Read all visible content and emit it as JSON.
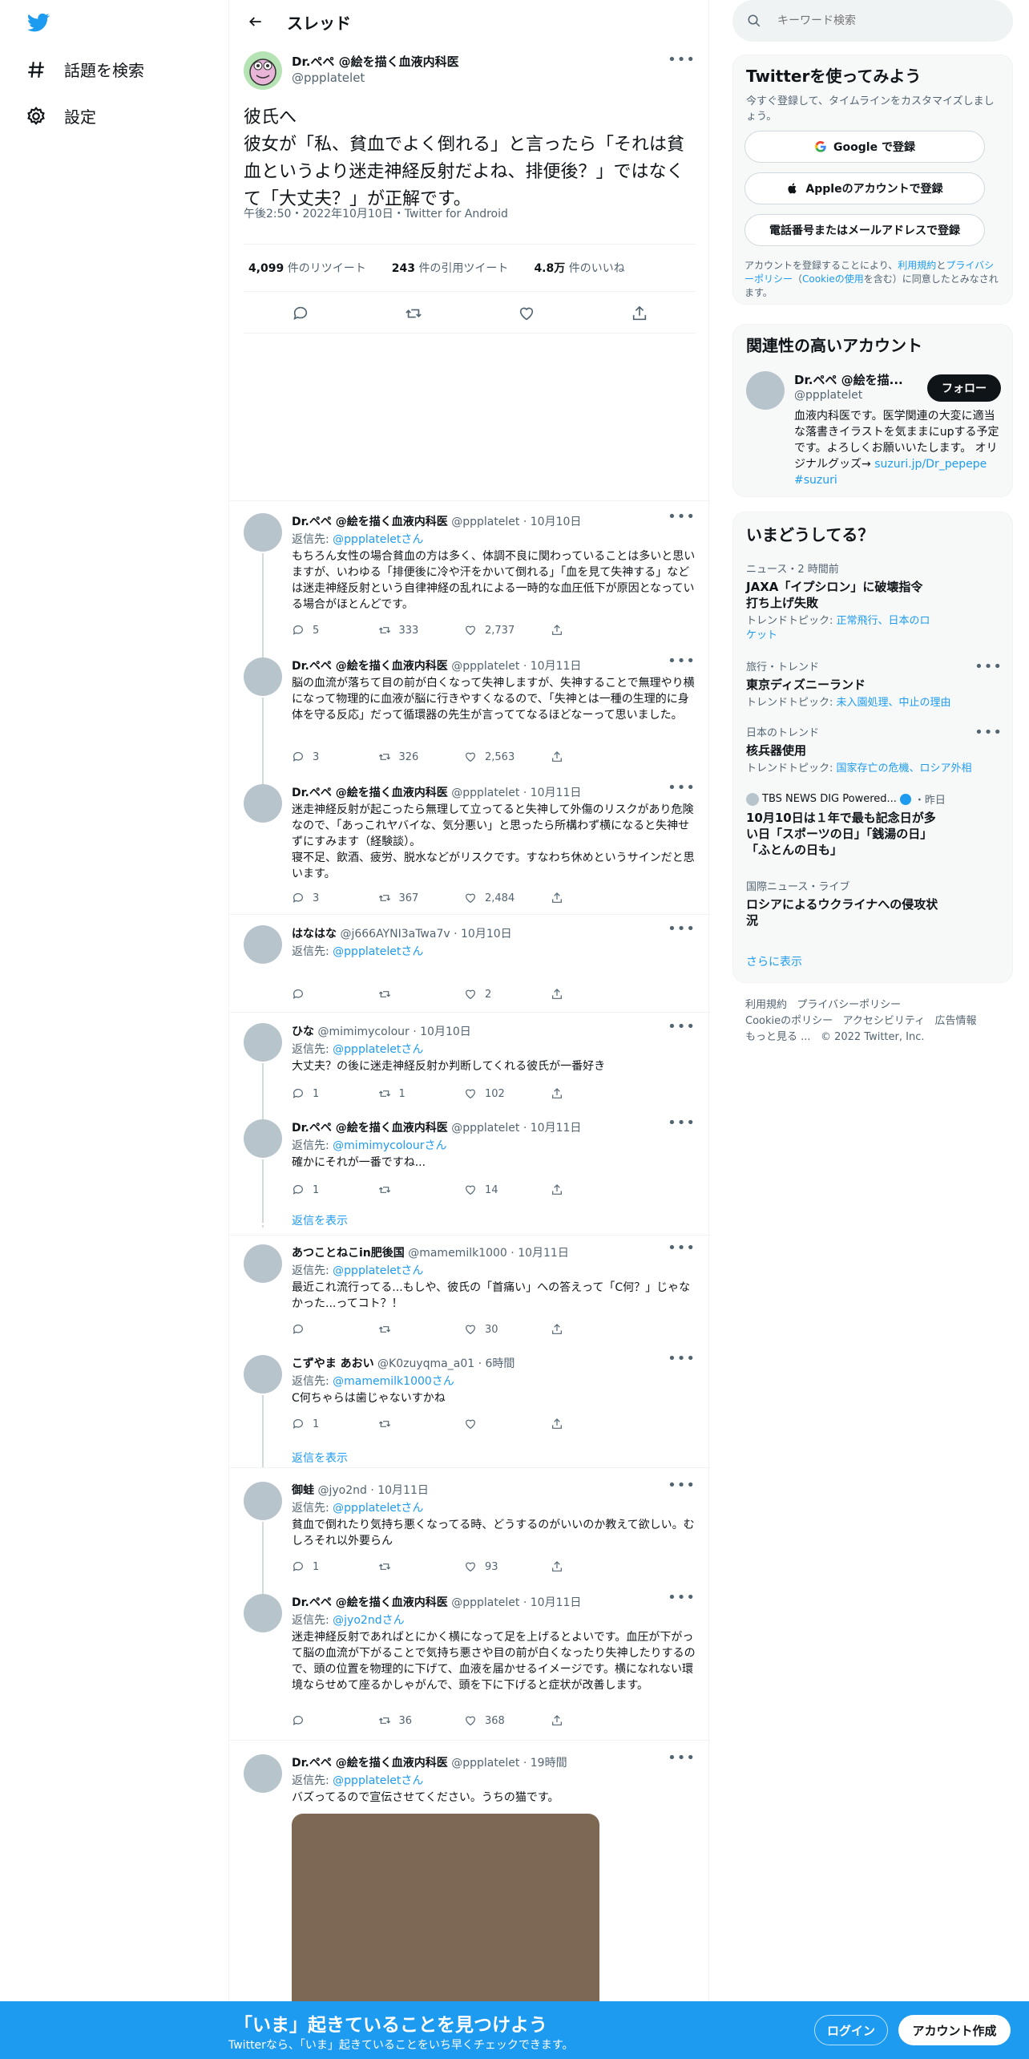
{
  "nav": {
    "explore": "話題を検索",
    "settings": "設定"
  },
  "header": {
    "title": "スレッド"
  },
  "main_tweet": {
    "name": "Dr.ペペ @絵を描く血液内科医",
    "handle": "@ppplatelet",
    "text": "彼氏へ\n彼女が「私、貧血でよく倒れる」と言ったら「それは貧血というより迷走神経反射だよね、排便後？」ではなくて「大丈夫？」が正解です。",
    "meta": "午後2:50・2022年10月10日・Twitter for Android",
    "retweets_num": "4,099",
    "retweets_label": "件のリツイート",
    "quotes_num": "243",
    "quotes_label": "件の引用ツイート",
    "likes_num": "4.8万",
    "likes_label": "件のいいね"
  },
  "replies": [
    {
      "name": "Dr.ペペ @絵を描く血液内科医",
      "handle": "@ppplatelet",
      "time": "· 10月10日",
      "reply_to_prefix": "返信先: ",
      "reply_to": "@ppplatelet",
      "reply_to_suffix": "さん",
      "text": "もちろん女性の場合貧血の方は多く、体調不良に関わっていることは多いと思いますが、いわゆる「排便後に冷や汗をかいて倒れる」「血を見て失神する」などは迷走神経反射という自律神経の乱れによる一時的な血圧低下が原因となっている場合がほとんどです。",
      "replies": "5",
      "retweets": "333",
      "likes": "2,737"
    },
    {
      "name": "Dr.ペペ @絵を描く血液内科医",
      "handle": "@ppplatelet",
      "time": "· 10月11日",
      "text": "脳の血流が落ちて目の前が白くなって失神しますが、失神することで無理やり横になって物理的に血液が脳に行きやすくなるので、「失神とは一種の生理的に身体を守る反応」だって循環器の先生が言っててなるほどなーって思いました。",
      "replies": "3",
      "retweets": "326",
      "likes": "2,563"
    },
    {
      "name": "Dr.ペペ @絵を描く血液内科医",
      "handle": "@ppplatelet",
      "time": "· 10月11日",
      "text": "迷走神経反射が起こったら無理して立ってると失神して外傷のリスクがあり危険なので、「あっこれヤバイな、気分悪い」と思ったら所構わず横になると失神せずにすみます（経験談）。\n寝不足、飲酒、疲労、脱水などがリスクです。すなわち休めというサインだと思います。",
      "replies": "3",
      "retweets": "367",
      "likes": "2,484"
    },
    {
      "name": "はなはな",
      "handle": "@j666AYNI3aTwa7v",
      "time": "· 10月10日",
      "reply_to_prefix": "返信先: ",
      "reply_to": "@ppplatelet",
      "reply_to_suffix": "さん",
      "text": "",
      "replies": "",
      "retweets": "",
      "likes": "2"
    },
    {
      "name": "ひな",
      "handle": "@mimimycolour",
      "time": "· 10月10日",
      "reply_to_prefix": "返信先: ",
      "reply_to": "@ppplatelet",
      "reply_to_suffix": "さん",
      "text": "大丈夫？の後に迷走神経反射か判断してくれる彼氏が一番好き",
      "replies": "1",
      "retweets": "1",
      "likes": "102"
    },
    {
      "name": "Dr.ペペ @絵を描く血液内科医",
      "handle": "@ppplatelet",
      "time": "· 10月11日",
      "reply_to_prefix": "返信先: ",
      "reply_to": "@mimimycolour",
      "reply_to_suffix": "さん",
      "text": "確かにそれが一番ですね...",
      "replies": "1",
      "retweets": "",
      "likes": "14"
    },
    {
      "name": "あつことねこin肥後国",
      "handle": "@mamemilk1000",
      "time": "· 10月11日",
      "reply_to_prefix": "返信先: ",
      "reply_to": "@ppplatelet",
      "reply_to_suffix": "さん",
      "text": "最近これ流行ってる...もしや、彼氏の「首痛い」への答えって「C何？」じゃなかった...ってコト？！",
      "replies": "",
      "retweets": "",
      "likes": "30"
    },
    {
      "name": "こずやま あおい",
      "handle": "@K0zuyqma_a01",
      "time": "· 6時間",
      "reply_to_prefix": "返信先: ",
      "reply_to": "@mamemilk1000",
      "reply_to_suffix": "さん",
      "text": "C何ちゃらは歯じゃないすかね",
      "replies": "1",
      "retweets": "",
      "likes": ""
    },
    {
      "name": "御蛙",
      "handle": "@jyo2nd",
      "time": "· 10月11日",
      "reply_to_prefix": "返信先: ",
      "reply_to": "@ppplatelet",
      "reply_to_suffix": "さん",
      "text": "貧血で倒れたり気持ち悪くなってる時、どうするのがいいのか教えて欲しい。むしろそれ以外要らん",
      "replies": "1",
      "retweets": "",
      "likes": "93"
    },
    {
      "name": "Dr.ペペ @絵を描く血液内科医",
      "handle": "@ppplatelet",
      "time": "· 10月11日",
      "reply_to_prefix": "返信先: ",
      "reply_to": "@jyo2nd",
      "reply_to_suffix": "さん",
      "text": "迷走神経反射であればとにかく横になって足を上げるとよいです。血圧が下がって脳の血流が下がることで気持ち悪さや目の前が白くなったり失神したりするので、頭の位置を物理的に下げて、血液を届かせるイメージです。横になれない環境ならせめて座るかしゃがんで、頭を下に下げると症状が改善します。",
      "replies": "",
      "retweets": "36",
      "likes": "368"
    },
    {
      "name": "Dr.ペペ @絵を描く血液内科医",
      "handle": "@ppplatelet",
      "time": "· 19時間",
      "reply_to_prefix": "返信先: ",
      "reply_to": "@ppplatelet",
      "reply_to_suffix": "さん",
      "text": "バズってるので宣伝させてください。うちの猫です。"
    }
  ],
  "show_replies": "返信を表示",
  "sidebar": {
    "search_placeholder": "キーワード検索",
    "join": {
      "title": "Twitterを使ってみよう",
      "subtitle": "今すぐ登録して、タイムラインをカスタマイズしましょう。",
      "google": "Google で登録",
      "apple": "Appleのアカウントで登録",
      "phone": "電話番号またはメールアドレスで登録",
      "legal_1": "アカウントを登録することにより、",
      "legal_link1": "利用規約",
      "legal_2": "と",
      "legal_link2": "プライバシーポリシー",
      "legal_3": "（",
      "legal_link3": "Cookieの使用",
      "legal_4": "を含む）に同意したとみなされます。"
    },
    "related": {
      "title": "関連性の高いアカウント",
      "name": "Dr.ペペ @絵を描...",
      "handle": "@ppplatelet",
      "follow": "フォロー",
      "bio": "血液内科医です。医学関連の大変に適当な落書きイラストを気ままにupする予定です。よろしくお願いいたします。 オリジナルグッズ→",
      "bio_link": "suzuri.jp/Dr_pepepe #suzuri"
    },
    "trends": {
      "title": "いまどうしてる？",
      "items": [
        {
          "context": "ニュース・2 時間前",
          "title": "JAXA「イプシロン」に破壊指令 打ち上げ失敗",
          "sub_prefix": "トレンドトピック: ",
          "sub": "正常飛行、日本のロケット"
        },
        {
          "context": "旅行・トレンド",
          "title": "東京ディズニーランド",
          "sub_prefix": "トレンドトピック: ",
          "sub": "未入園処理、中止の理由"
        },
        {
          "context": "日本のトレンド",
          "title": "核兵器使用",
          "sub_prefix": "トレンドトピック: ",
          "sub": "国家存亡の危機、ロシア外相"
        },
        {
          "context": "TBS NEWS DIG Powered...",
          "context_time": "・昨日",
          "title": "10月10日は１年で最も記念日が多い日「スポーツの日」「銭湯の日」「ふとんの日も」"
        },
        {
          "context": "国際ニュース・ライブ",
          "title": "ロシアによるウクライナへの侵攻状況"
        }
      ],
      "more": "さらに表示"
    },
    "footer": {
      "terms": "利用規約",
      "privacy": "プライバシーポリシー",
      "cookie": "Cookieのポリシー",
      "accessibility": "アクセシビリティ",
      "ads": "広告情報",
      "more": "もっと見る ...",
      "copyright": "© 2022 Twitter, Inc."
    }
  },
  "bottom_bar": {
    "headline": "「いま」起きていることを見つけよう",
    "sub": "Twitterなら、「いま」起きていることをいち早くチェックできます。",
    "login": "ログイン",
    "signup": "アカウント作成"
  }
}
